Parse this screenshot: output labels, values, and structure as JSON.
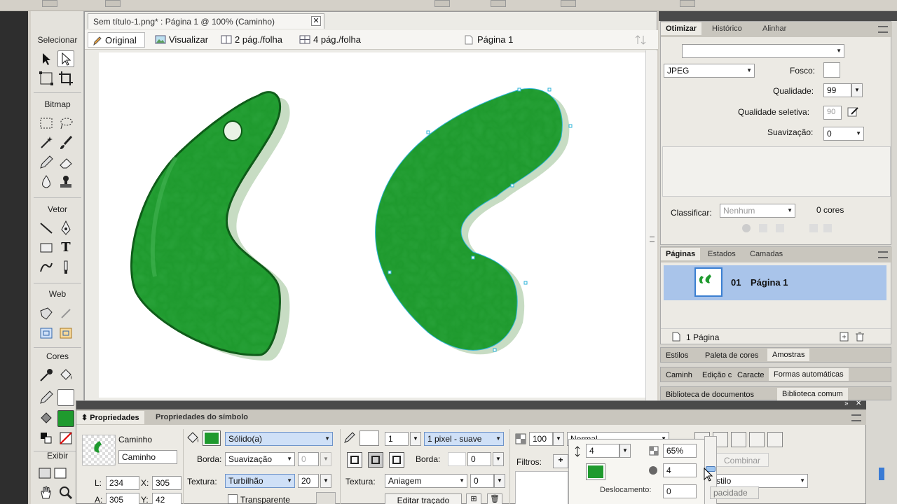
{
  "document": {
    "tab_title": "Sem título-1.png* : Página 1 @ 100% (Caminho)",
    "view_tabs": [
      "Original",
      "Visualizar",
      "2 pág./folha",
      "4 pág./folha"
    ],
    "page_label": "Página 1"
  },
  "tools": {
    "select_header": "Selecionar",
    "bitmap_header": "Bitmap",
    "vector_header": "Vetor",
    "web_header": "Web",
    "colors_header": "Cores",
    "view_header": "Exibir",
    "text_tool_glyph": "T",
    "fill_color": "#1f9a2e"
  },
  "optimize": {
    "tabs": [
      "Otimizar",
      "Histórico",
      "Alinhar"
    ],
    "format": "JPEG",
    "matte_label": "Fosco:",
    "quality_label": "Qualidade:",
    "quality_value": "99",
    "selective_quality_label": "Qualidade seletiva:",
    "selective_quality_value": "90",
    "smoothing_label": "Suavização:",
    "smoothing_value": "0",
    "sort_label": "Classificar:",
    "sort_value": "Nenhum",
    "colors_count": "0 cores"
  },
  "pages": {
    "tabs": [
      "Páginas",
      "Estados",
      "Camadas"
    ],
    "items": [
      {
        "number": "01",
        "name": "Página 1"
      }
    ],
    "footer_count": "1 Página"
  },
  "panels": {
    "group1": [
      "Estilos",
      "Paleta de cores",
      "Amostras"
    ],
    "group2": [
      "Caminh",
      "Edição c",
      "Caracte",
      "Formas automáticas"
    ],
    "group3": [
      "Biblioteca de documentos",
      "Biblioteca comum"
    ]
  },
  "properties": {
    "tabs": [
      "Propriedades",
      "Propriedades do símbolo"
    ],
    "object_type": "Caminho",
    "object_name": "Caminho",
    "L_label": "L:",
    "L_value": "234",
    "A_label": "A:",
    "A_value": "305",
    "X_label": "X:",
    "X_value": "305",
    "Y_label": "Y:",
    "Y_value": "42",
    "fill_type": "Sólido(a)",
    "edge_label": "Borda:",
    "fill_edge": "Suavização",
    "fill_edge_value": "0",
    "texture_label": "Textura:",
    "fill_texture": "Turbilhão",
    "fill_texture_value": "20",
    "transparent_label": "Transparente",
    "stroke_size": "1",
    "stroke_type": "1 pixel - suave",
    "stroke_edge_value": "0",
    "stroke_texture": "Aniagem",
    "stroke_texture_value": "0",
    "edit_stroke_button": "Editar traçado",
    "opacity_value": "100",
    "blend_mode": "Normal",
    "filters_label": "Filtros:",
    "filter_distance": "4",
    "filter_opacity": "65%",
    "filter_softness": "4",
    "filter_offset_label": "Deslocamento:",
    "filter_offset_value": "0",
    "combine_label": "Combinar",
    "style_label": "stilo",
    "tooltip_opacity": "pacidade"
  }
}
